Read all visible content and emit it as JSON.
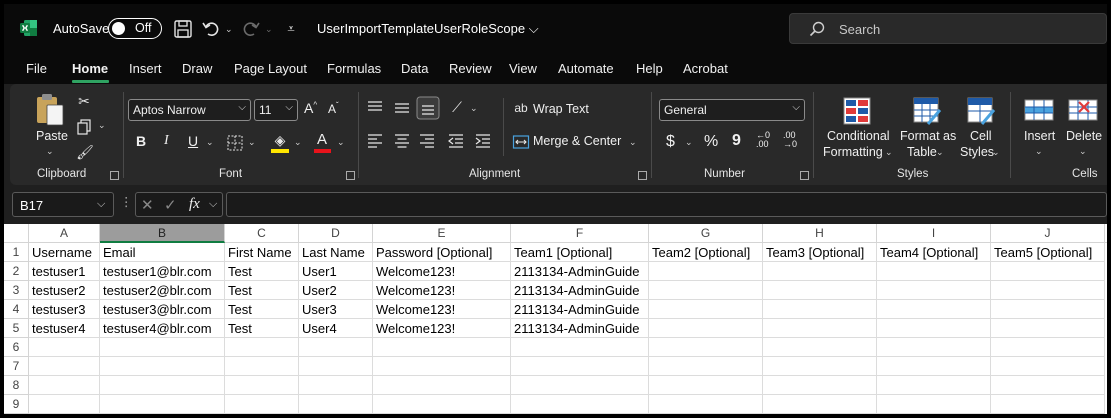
{
  "titlebar": {
    "autosave_label": "AutoSave",
    "autosave_state": "Off",
    "doc_title": "UserImportTemplateUserRoleScope ⌵",
    "search_placeholder": "Search"
  },
  "menu": {
    "tabs": [
      "File",
      "Home",
      "Insert",
      "Draw",
      "Page Layout",
      "Formulas",
      "Data",
      "Review",
      "View",
      "Automate",
      "Help",
      "Acrobat"
    ],
    "active_tab": "Home"
  },
  "ribbon": {
    "clipboard": {
      "paste": "Paste",
      "label": "Clipboard"
    },
    "font": {
      "font_name": "Aptos Narrow",
      "font_size": "11",
      "bold": "B",
      "italic": "I",
      "underline": "U",
      "label": "Font"
    },
    "alignment": {
      "wrap_text": "Wrap Text",
      "merge_center": "Merge & Center",
      "label": "Alignment"
    },
    "number": {
      "format": "General",
      "currency": "$",
      "percent": "%",
      "comma": "9",
      "label": "Number"
    },
    "styles": {
      "conditional_1": "Conditional",
      "conditional_2": "Formatting",
      "format_table_1": "Format as",
      "format_table_2": "Table",
      "cell_styles_1": "Cell",
      "cell_styles_2": "Styles",
      "label": "Styles"
    },
    "cells": {
      "insert": "Insert",
      "delete": "Delete",
      "label": "Cells"
    },
    "colors": {
      "font_color": "#e8131b",
      "highlight": "#ffe600",
      "accent": "#2fa362"
    }
  },
  "formula_bar": {
    "name_box": "B17",
    "fx": "fx",
    "value": ""
  },
  "sheet": {
    "columns": [
      "A",
      "B",
      "C",
      "D",
      "E",
      "F",
      "G",
      "H",
      "I",
      "J"
    ],
    "selected_column": "B",
    "row_numbers": [
      "1",
      "2",
      "3",
      "4",
      "5",
      "6",
      "7",
      "8",
      "9"
    ],
    "rows": [
      [
        "Username",
        "Email",
        "First Name",
        "Last Name",
        "Password [Optional]",
        "Team1 [Optional]",
        "Team2 [Optional]",
        "Team3 [Optional]",
        "Team4 [Optional]",
        "Team5 [Optional]"
      ],
      [
        "testuser1",
        "testuser1@blr.com",
        "Test",
        "User1",
        "Welcome123!",
        "2113134-AdminGuide",
        "",
        "",
        "",
        ""
      ],
      [
        "testuser2",
        "testuser2@blr.com",
        "Test",
        "User2",
        "Welcome123!",
        "2113134-AdminGuide",
        "",
        "",
        "",
        ""
      ],
      [
        "testuser3",
        "testuser3@blr.com",
        "Test",
        "User3",
        "Welcome123!",
        "2113134-AdminGuide",
        "",
        "",
        "",
        ""
      ],
      [
        "testuser4",
        "testuser4@blr.com",
        "Test",
        "User4",
        "Welcome123!",
        "2113134-AdminGuide",
        "",
        "",
        "",
        ""
      ],
      [
        "",
        "",
        "",
        "",
        "",
        "",
        "",
        "",
        "",
        ""
      ],
      [
        "",
        "",
        "",
        "",
        "",
        "",
        "",
        "",
        "",
        ""
      ],
      [
        "",
        "",
        "",
        "",
        "",
        "",
        "",
        "",
        "",
        ""
      ],
      [
        "",
        "",
        "",
        "",
        "",
        "",
        "",
        "",
        "",
        ""
      ]
    ]
  }
}
